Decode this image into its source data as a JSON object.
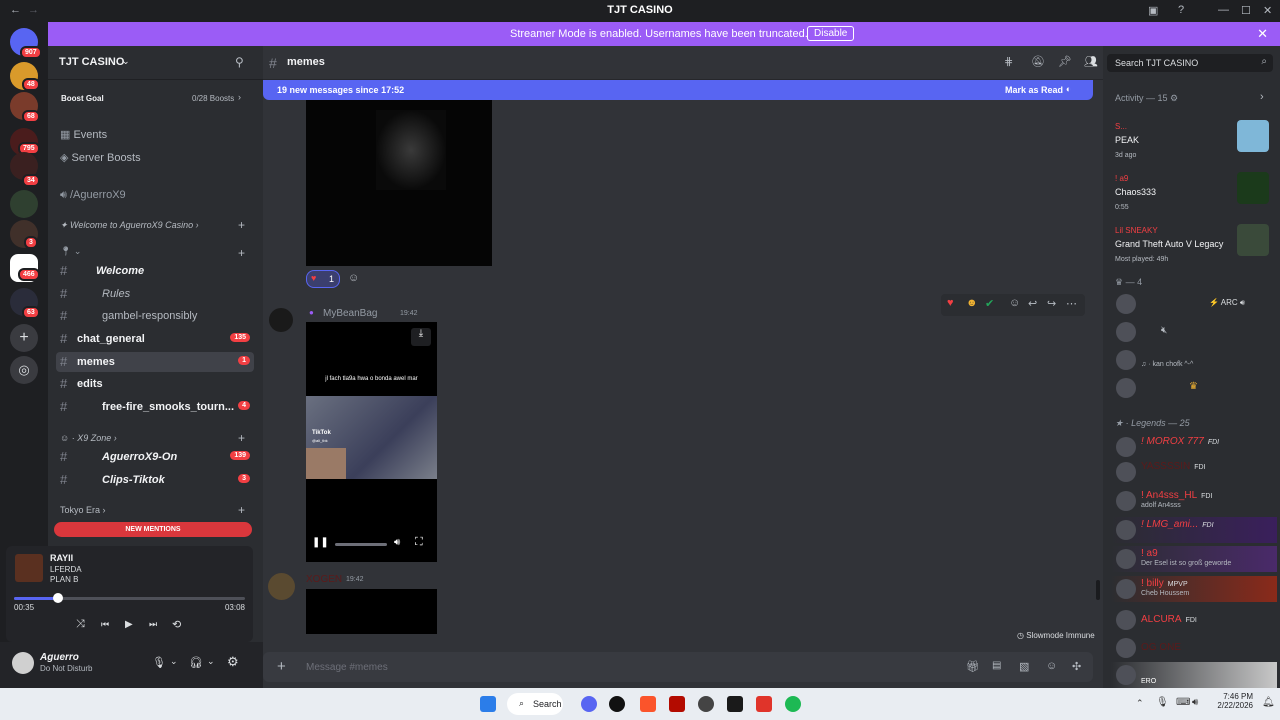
{
  "window": {
    "title": "TJT CASINO"
  },
  "banner": {
    "message": "Streamer Mode is enabled. Usernames have been truncated.",
    "button": "Disable"
  },
  "rail": {
    "badges": [
      "907",
      "48",
      "68",
      "795",
      "34",
      "3",
      "466",
      "63"
    ]
  },
  "server": {
    "name": "TJT CASINO",
    "boost_goal": "Boost Goal",
    "boosts": "0/28 Boosts",
    "events": "Events",
    "server_boosts": "Server Boosts",
    "voice": "/AguerroX9",
    "new_mentions": "NEW MENTIONS"
  },
  "channels": [
    {
      "cat": "Welcome to AguerroX9 Casino"
    },
    {
      "name": "Welcome"
    },
    {
      "name": "Rules"
    },
    {
      "name": "gambel-responsibly"
    },
    {
      "name": "chat_general",
      "count": "135"
    },
    {
      "name": "memes",
      "count": "1"
    },
    {
      "name": "edits"
    },
    {
      "name": "free-fire_smooks_tourn...",
      "count": "4"
    },
    {
      "cat": "X9 Zone"
    },
    {
      "name": "AguerroX9-On",
      "count": "139"
    },
    {
      "name": "Clips-Tiktok",
      "count": "3"
    },
    {
      "cat": "Tokyo Era"
    }
  ],
  "player": {
    "title": "RAYII",
    "artist": "LFERDA",
    "album": "PLAN B",
    "elapsed": "00:35",
    "total": "03:08",
    "progress": 0.19
  },
  "user": {
    "name": "Aguerro",
    "status": "Do Not Disturb"
  },
  "chat": {
    "channel": "memes",
    "search_placeholder": "Search TJT CASINO",
    "new_messages": "19 new messages since 17:52",
    "mark_read": "Mark as Read",
    "reaction_count": "1",
    "msg1_author": "MyBeanBag",
    "msg1_time": "19:42",
    "video_caption": "jl fach tla9a hwa o bonda awel mar",
    "tiktok": "TikTok",
    "tiktok_user": "@ali_tbk",
    "msg2_author": "XOGEN",
    "msg2_time": "19:42",
    "slowmode": "Slowmode Immune",
    "composer_placeholder": "Message #memes"
  },
  "members": {
    "activity_header": "Activity — 15",
    "activity": [
      {
        "name": "S...",
        "title": "PEAK",
        "sub": "3d ago"
      },
      {
        "name": "! a9",
        "title": "Chaos333",
        "sub": "0:55"
      },
      {
        "name": "Lil SNEAKY",
        "title": "Grand Theft Auto V Legacy",
        "sub": "Most played: 49h"
      }
    ],
    "group_count": "— 4",
    "arc": "ARC",
    "kan_status": "kan chofk ^-^",
    "legends_header": "Legends — 25",
    "legends": [
      {
        "name": "! MOROX 777",
        "tag": "FDI",
        "status": ""
      },
      {
        "name": "YASSSSIN",
        "tag": "FDI",
        "status": ""
      },
      {
        "name": "! An4sss_HL",
        "tag": "FDI",
        "status": "adolf An4sss"
      },
      {
        "name": "! LMG_ami...",
        "tag": "FDI",
        "status": ""
      },
      {
        "name": "! a9",
        "tag": "",
        "status": "Der Esel ist so groß geworde"
      },
      {
        "name": "! billy",
        "tag": "MPVP",
        "status": "Cheb Houssem"
      },
      {
        "name": "ALCURA",
        "tag": "FDI",
        "status": ""
      },
      {
        "name": "OG ONE",
        "tag": "",
        "status": ""
      },
      {
        "name": "",
        "tag": "",
        "status": "ERO"
      }
    ]
  },
  "taskbar": {
    "search": "Search",
    "time": "7:46 PM",
    "date": "2/22/2026"
  }
}
